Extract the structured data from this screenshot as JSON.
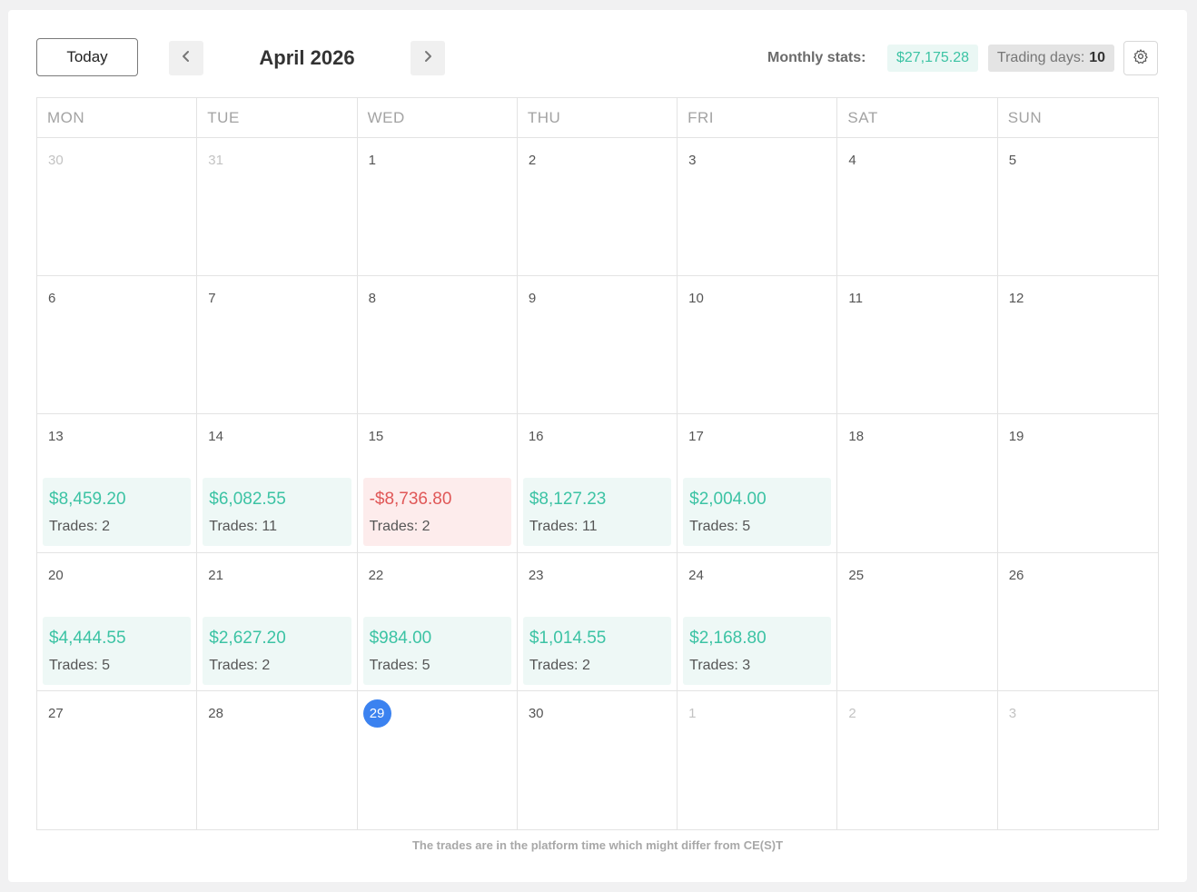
{
  "header": {
    "today_label": "Today",
    "month_title": "April 2026",
    "monthly_stats_label": "Monthly stats:",
    "monthly_stats_value": "$27,175.28",
    "trading_days_label": "Trading days:",
    "trading_days_value": "10",
    "prev_icon": "chevron-left-icon",
    "next_icon": "chevron-right-icon",
    "settings_icon": "gear-icon"
  },
  "weekdays": [
    "MON",
    "TUE",
    "WED",
    "THU",
    "FRI",
    "SAT",
    "SUN"
  ],
  "weeks": [
    [
      {
        "day": "30",
        "muted": true
      },
      {
        "day": "31",
        "muted": true
      },
      {
        "day": "1"
      },
      {
        "day": "2"
      },
      {
        "day": "3"
      },
      {
        "day": "4"
      },
      {
        "day": "5"
      }
    ],
    [
      {
        "day": "6"
      },
      {
        "day": "7"
      },
      {
        "day": "8"
      },
      {
        "day": "9"
      },
      {
        "day": "10"
      },
      {
        "day": "11"
      },
      {
        "day": "12"
      }
    ],
    [
      {
        "day": "13",
        "pnl": "$8,459.20",
        "trades": "Trades: 2"
      },
      {
        "day": "14",
        "pnl": "$6,082.55",
        "trades": "Trades: 11"
      },
      {
        "day": "15",
        "pnl": "-$8,736.80",
        "trades": "Trades: 2",
        "negative": true
      },
      {
        "day": "16",
        "pnl": "$8,127.23",
        "trades": "Trades: 11"
      },
      {
        "day": "17",
        "pnl": "$2,004.00",
        "trades": "Trades: 5"
      },
      {
        "day": "18"
      },
      {
        "day": "19"
      }
    ],
    [
      {
        "day": "20",
        "pnl": "$4,444.55",
        "trades": "Trades: 5"
      },
      {
        "day": "21",
        "pnl": "$2,627.20",
        "trades": "Trades: 2"
      },
      {
        "day": "22",
        "pnl": "$984.00",
        "trades": "Trades: 5"
      },
      {
        "day": "23",
        "pnl": "$1,014.55",
        "trades": "Trades: 2"
      },
      {
        "day": "24",
        "pnl": "$2,168.80",
        "trades": "Trades: 3"
      },
      {
        "day": "25"
      },
      {
        "day": "26"
      }
    ],
    [
      {
        "day": "27"
      },
      {
        "day": "28"
      },
      {
        "day": "29",
        "current": true
      },
      {
        "day": "30"
      },
      {
        "day": "1",
        "muted": true
      },
      {
        "day": "2",
        "muted": true
      },
      {
        "day": "3",
        "muted": true
      }
    ]
  ],
  "footnote": "The trades are in the platform time which might differ from CE(S)T",
  "colors": {
    "positive": "#3cc3a4",
    "negative": "#e05757",
    "positive_bg": "#eef8f6",
    "negative_bg": "#fdecec",
    "today_marker": "#3b82f0"
  }
}
